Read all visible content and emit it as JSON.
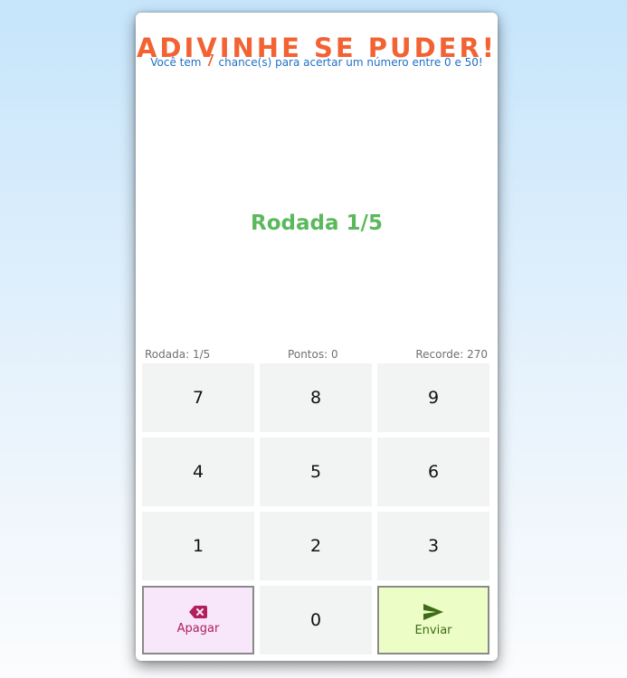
{
  "header": {
    "title": "ADIVINHE SE PUDER!",
    "subtitle_before": "Você tem ",
    "chances": "7",
    "subtitle_after": " chance(s) para acertar um número entre 0 e 50!"
  },
  "main": {
    "round_title": "Rodada 1/5"
  },
  "stats": {
    "round": "Rodada: 1/5",
    "points": "Pontos: 0",
    "record": "Recorde: 270"
  },
  "keypad": {
    "k7": "7",
    "k8": "8",
    "k9": "9",
    "k4": "4",
    "k5": "5",
    "k6": "6",
    "k1": "1",
    "k2": "2",
    "k3": "3",
    "k0": "0",
    "delete_label": "Apagar",
    "submit_label": "Enviar",
    "delete_icon": "backspace-icon",
    "submit_icon": "send-icon"
  },
  "colors": {
    "title": "#f26232",
    "subtitle": "#1f6fc5",
    "round": "#5cb85c",
    "delete_bg": "#f8e6fb",
    "delete_fg": "#b2205b",
    "submit_bg": "#edfdc6",
    "submit_fg": "#3e6b18",
    "key_bg": "#f2f3f3"
  }
}
